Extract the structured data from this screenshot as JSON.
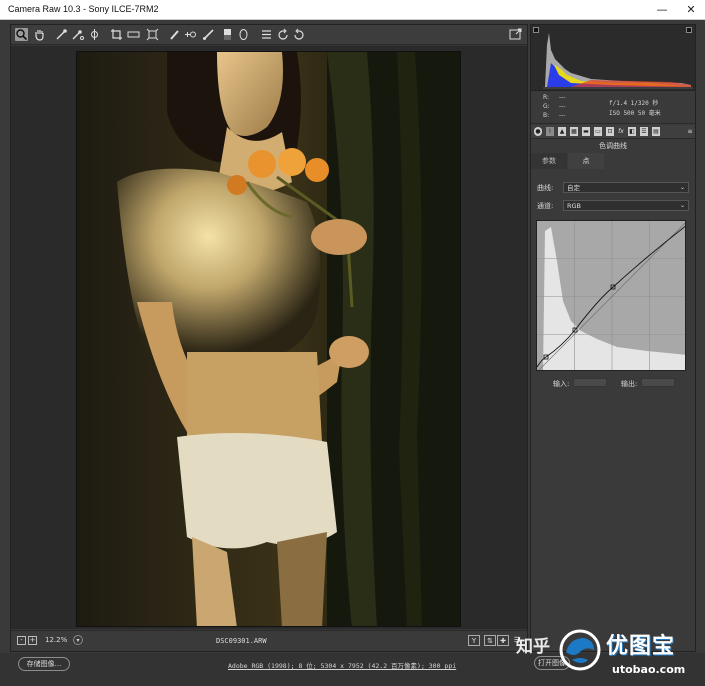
{
  "window": {
    "title": "Camera Raw 10.3 -  Sony ILCE-7RM2",
    "minimize": "—",
    "close": "✕"
  },
  "toolbar": {
    "tools": [
      {
        "name": "zoom-tool",
        "glyph": "🔍"
      },
      {
        "name": "hand-tool",
        "glyph": "✋"
      },
      {
        "name": "white-balance-tool",
        "glyph": "✎"
      },
      {
        "name": "color-sampler-tool",
        "glyph": "✎"
      },
      {
        "name": "targeted-adjustment-tool",
        "glyph": "◎"
      },
      {
        "name": "crop-tool",
        "glyph": "⌗"
      },
      {
        "name": "straighten-tool",
        "glyph": "▭"
      },
      {
        "name": "transform-tool",
        "glyph": "⊡"
      },
      {
        "name": "spot-removal-tool",
        "glyph": "✐"
      },
      {
        "name": "red-eye-tool",
        "glyph": "+⊙"
      },
      {
        "name": "adjustment-brush-tool",
        "glyph": "✎"
      },
      {
        "name": "graduated-filter-tool",
        "glyph": "▤"
      },
      {
        "name": "radial-filter-tool",
        "glyph": "◯"
      },
      {
        "name": "preferences-tool",
        "glyph": "☰"
      },
      {
        "name": "rotate-left-tool",
        "glyph": "↺"
      },
      {
        "name": "rotate-right-tool",
        "glyph": "↻"
      }
    ],
    "fullscreen_glyph": "⇱"
  },
  "bottom": {
    "minus": "-",
    "plus": "+",
    "zoom": "12.2%",
    "filename": "DSC09301.ARW",
    "view_y": "Y",
    "view_b": "▣"
  },
  "footer": {
    "save": "存储图像...",
    "workflow": "Adobe RGB (1998); 8 位; 5304 x 7952 (42.2 百万像素); 300 ppi",
    "open": "打开图像"
  },
  "info": {
    "r": "R:",
    "g": "G:",
    "b": "B:",
    "dash": "---",
    "aperture_shutter": "f/1.4  1/320 秒",
    "iso_focal": "ISO 500  50 毫米"
  },
  "panel": {
    "section_title": "色调曲线",
    "tab_param": "参数",
    "tab_point": "点",
    "curve_label": "曲线:",
    "curve_value": "自定",
    "channel_label": "通道:",
    "channel_value": "RGB",
    "input_label": "输入:",
    "output_label": "输出:"
  },
  "curve": {
    "points": [
      [
        0,
        3
      ],
      [
        0.06,
        0.09
      ],
      [
        0.27,
        0.27
      ],
      [
        0.55,
        0.57
      ],
      [
        1.0,
        0.97
      ]
    ],
    "note": ""
  },
  "watermark": {
    "zhihu": "知乎",
    "brand": "优图宝",
    "url": "utobao.com"
  },
  "colors": {
    "accent": "#1c79c6",
    "panel_bg": "#3a3a3a",
    "curve_bg": "#a8a8a8"
  }
}
